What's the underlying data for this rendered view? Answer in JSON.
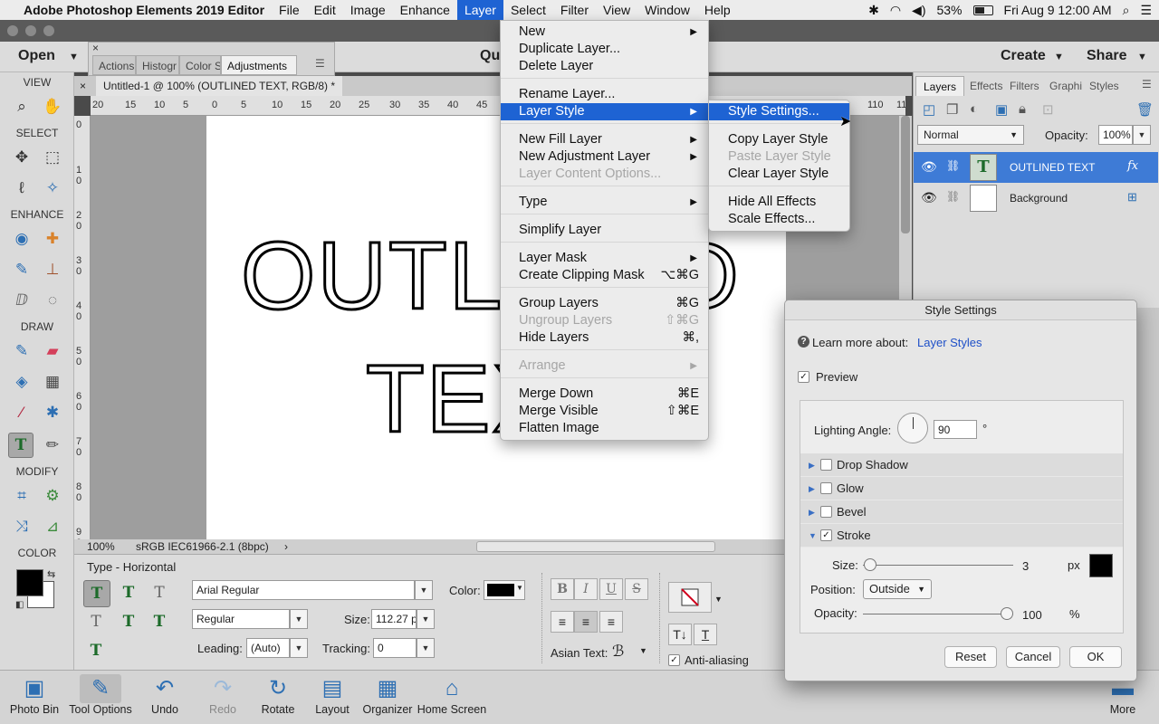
{
  "menubar": {
    "apple": "",
    "app_name": "Adobe Photoshop Elements 2019 Editor",
    "items": [
      "File",
      "Edit",
      "Image",
      "Enhance",
      "Layer",
      "Select",
      "Filter",
      "View",
      "Window",
      "Help"
    ],
    "active_item": "Layer",
    "battery": "53%",
    "datetime": "Fri Aug 9  12:00 AM"
  },
  "appbar": {
    "open_label": "Open",
    "quick_label": "Qui",
    "create_label": "Create",
    "share_label": "Share"
  },
  "float_panel": {
    "tabs": [
      "Actions",
      "Histogr",
      "Color S",
      "Adjustments"
    ],
    "selected_tab": "Adjustments"
  },
  "toolbar": {
    "sections": [
      "VIEW",
      "SELECT",
      "ENHANCE",
      "DRAW",
      "MODIFY",
      "COLOR"
    ],
    "selected_tool": "type-tool"
  },
  "document": {
    "tab_title": "Untitled-1 @ 100% (OUTLINED TEXT, RGB/8) *",
    "ruler_h_ticks": [
      "20",
      "15",
      "10",
      "5",
      "0",
      "5",
      "10",
      "15",
      "20",
      "25",
      "30",
      "35",
      "40",
      "45",
      "110",
      "115"
    ],
    "ruler_v_ticks": [
      "0",
      "1\n0",
      "2\n0",
      "3\n0",
      "4\n0",
      "5\n0",
      "6\n0",
      "7\n0",
      "8\n0",
      "9\n0"
    ],
    "canvas_line1": "OUTLINED",
    "canvas_line2": "TEXT",
    "zoom": "100%",
    "color_profile": "sRGB IEC61966-2.1 (8bpc)"
  },
  "tool_options": {
    "title": "Type - Horizontal",
    "font_family": "Arial Regular",
    "font_style": "Regular",
    "size_label": "Size:",
    "size_value": "112.27 p",
    "leading_label": "Leading:",
    "leading_value": "(Auto)",
    "tracking_label": "Tracking:",
    "tracking_value": "0",
    "color_label": "Color:",
    "text_color": "#000000",
    "bold": "B",
    "italic": "I",
    "underline": "U",
    "strike": "S",
    "asian_text_label": "Asian Text:",
    "anti_aliasing_label": "Anti-aliasing",
    "anti_aliasing_checked": true
  },
  "bottom_bar": {
    "items": [
      "Photo Bin",
      "Tool Options",
      "Undo",
      "Redo",
      "Rotate",
      "Layout",
      "Organizer",
      "Home Screen",
      "More"
    ]
  },
  "layers_panel": {
    "tabs": [
      "Layers",
      "Effects",
      "Filters",
      "Graphi",
      "Styles"
    ],
    "blend_mode": "Normal",
    "opacity_label": "Opacity:",
    "opacity_value": "100%",
    "layers": [
      {
        "name": "OUTLINED TEXT",
        "thumb": "T",
        "fx": "fx",
        "selected": true
      },
      {
        "name": "Background",
        "thumb": "",
        "fx": "",
        "selected": false
      }
    ]
  },
  "layer_menu": {
    "items": [
      {
        "label": "New",
        "arrow": "▶"
      },
      {
        "label": "Duplicate Layer..."
      },
      {
        "label": "Delete Layer"
      },
      {
        "label": "Rename Layer..."
      },
      {
        "label": "Layer Style",
        "arrow": "▶",
        "highlight": true
      },
      {
        "label": "New Fill Layer",
        "arrow": "▶"
      },
      {
        "label": "New Adjustment Layer",
        "arrow": "▶"
      },
      {
        "label": "Layer Content Options...",
        "disabled": true
      },
      {
        "label": "Type",
        "arrow": "▶"
      },
      {
        "label": "Simplify Layer"
      },
      {
        "label": "Layer Mask",
        "arrow": "▶"
      },
      {
        "label": "Create Clipping Mask",
        "shortcut": "⌥⌘G"
      },
      {
        "label": "Group Layers",
        "shortcut": "⌘G"
      },
      {
        "label": "Ungroup Layers",
        "shortcut": "⇧⌘G",
        "disabled": true
      },
      {
        "label": "Hide Layers",
        "shortcut": "⌘,"
      },
      {
        "label": "Arrange",
        "arrow": "▶",
        "disabled": true
      },
      {
        "label": "Merge Down",
        "shortcut": "⌘E"
      },
      {
        "label": "Merge Visible",
        "shortcut": "⇧⌘E"
      },
      {
        "label": "Flatten Image"
      }
    ]
  },
  "layer_style_submenu": {
    "items": [
      {
        "label": "Style Settings...",
        "highlight": true
      },
      {
        "label": "Copy Layer Style"
      },
      {
        "label": "Paste Layer Style",
        "disabled": true
      },
      {
        "label": "Clear Layer Style"
      },
      {
        "label": "Hide All Effects"
      },
      {
        "label": "Scale Effects..."
      }
    ]
  },
  "style_settings": {
    "title": "Style Settings",
    "learn_more": "Learn more about:",
    "learn_link": "Layer Styles",
    "preview_label": "Preview",
    "preview_checked": true,
    "lighting_angle_label": "Lighting Angle:",
    "lighting_angle_value": "90",
    "degree_symbol": "°",
    "effects": [
      {
        "label": "Drop Shadow",
        "checked": false,
        "expanded": false
      },
      {
        "label": "Glow",
        "checked": false,
        "expanded": false
      },
      {
        "label": "Bevel",
        "checked": false,
        "expanded": false
      },
      {
        "label": "Stroke",
        "checked": true,
        "expanded": true
      }
    ],
    "stroke": {
      "size_label": "Size:",
      "size_value": "3",
      "size_unit": "px",
      "size_fraction": 0.03,
      "color": "#000000",
      "position_label": "Position:",
      "position_value": "Outside",
      "opacity_label": "Opacity:",
      "opacity_value": "100",
      "opacity_unit": "%"
    },
    "reset_label": "Reset",
    "cancel_label": "Cancel",
    "ok_label": "OK"
  },
  "colors": {
    "accent": "#1e63d3",
    "layer_selected": "#3e7bd6"
  }
}
